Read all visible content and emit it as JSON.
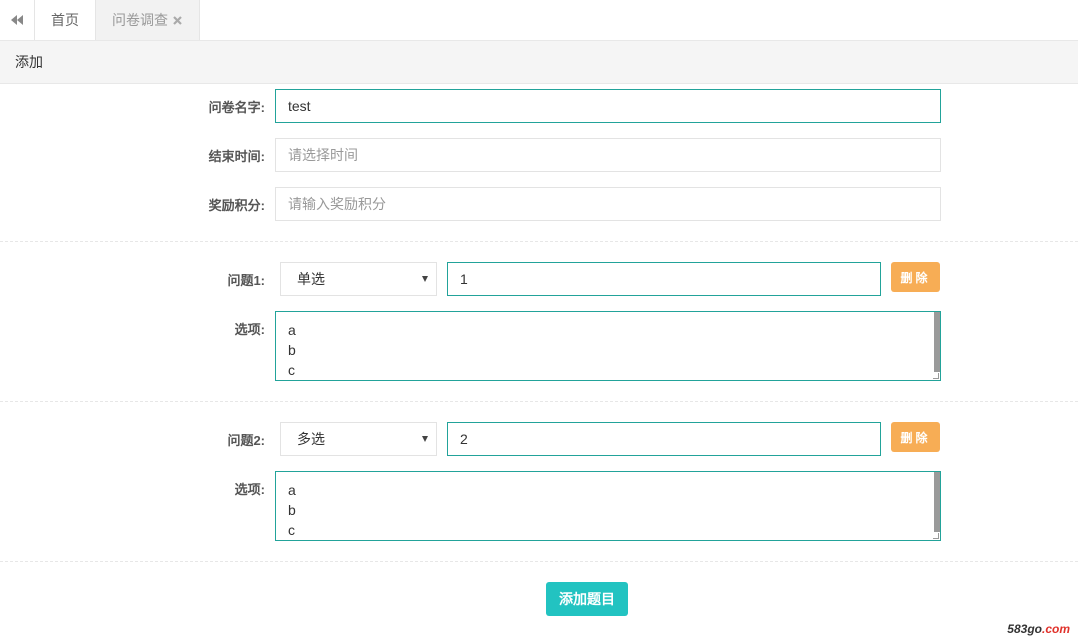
{
  "tabs": {
    "back_icon": "double-chevron-left-icon",
    "home_label": "首页",
    "active_label": "问卷调查",
    "close_icon": "close-icon"
  },
  "toolbar": {
    "add_label": "添加"
  },
  "form": {
    "name_label": "问卷名字:",
    "name_value": "test",
    "end_time_label": "结束时间:",
    "end_time_placeholder": "请选择时间",
    "points_label": "奖励积分:",
    "points_placeholder": "请输入奖励积分"
  },
  "questions": [
    {
      "label": "问题1:",
      "type": "单选",
      "title": "1",
      "options_label": "选项:",
      "options": [
        "a",
        "b",
        "c"
      ],
      "delete_label": "删除"
    },
    {
      "label": "问题2:",
      "type": "多选",
      "title": "2",
      "options_label": "选项:",
      "options": [
        "a",
        "b",
        "c"
      ],
      "delete_label": "删除"
    }
  ],
  "add_question_label": "添加题目",
  "watermark": {
    "main": "583go",
    "suffix": ".com"
  },
  "colors": {
    "accent": "#22a39a",
    "delete_button": "#f7ad55",
    "add_button": "#22c3c1"
  }
}
